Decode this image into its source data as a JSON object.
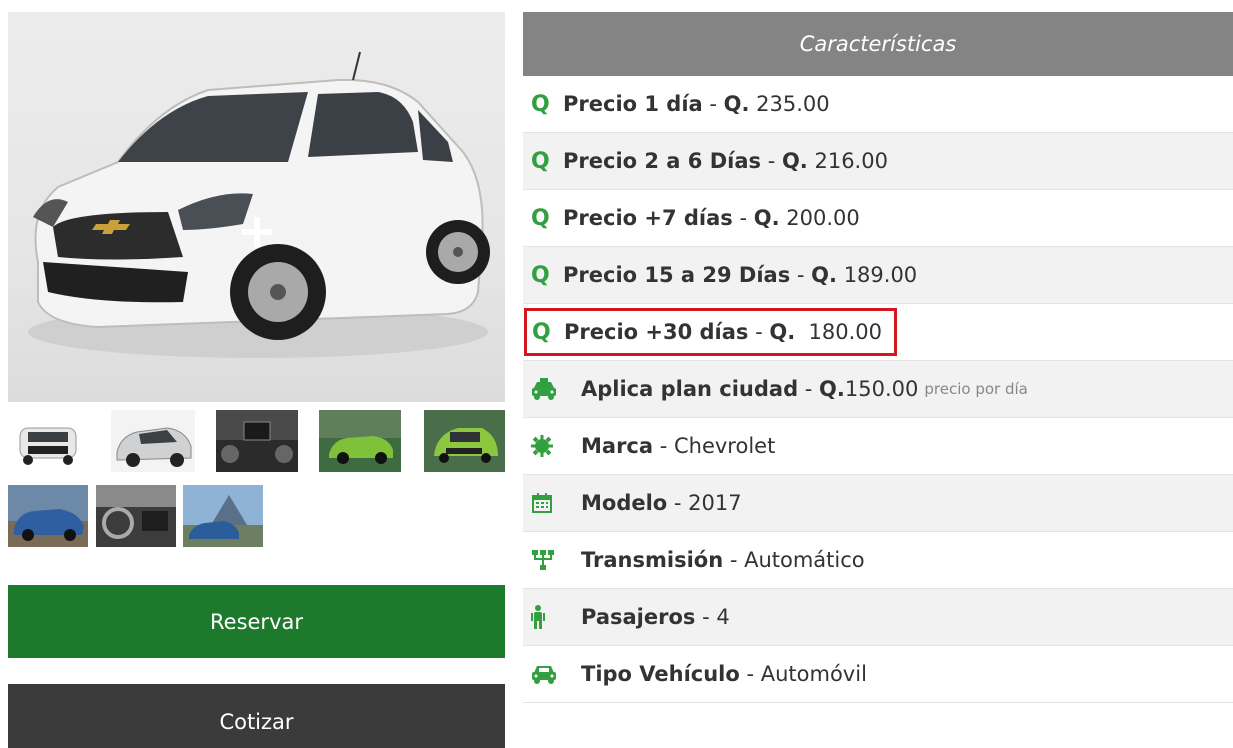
{
  "gallery": {
    "thumbnails_row1": [
      "car-front-white",
      "car-side-silver",
      "car-dashboard",
      "car-green-side",
      "car-green-front"
    ],
    "thumbnails_row2": [
      "car-blue-road",
      "car-interior",
      "car-blue-volcano"
    ]
  },
  "buttons": {
    "reservar": "Reservar",
    "cotizar": "Cotizar"
  },
  "features": {
    "header": "Características",
    "rows": [
      {
        "icon": "quetzal-icon",
        "label": "Precio 1 día",
        "sep": " - ",
        "currency": "Q.",
        "value": " 235.00"
      },
      {
        "icon": "quetzal-icon",
        "label": "Precio 2 a 6 Días",
        "sep": " - ",
        "currency": "Q.",
        "value": " 216.00"
      },
      {
        "icon": "quetzal-icon",
        "label": "Precio +7 días",
        "sep": " - ",
        "currency": "Q.",
        "value": " 200.00"
      },
      {
        "icon": "quetzal-icon",
        "label": "Precio 15 a 29 Días",
        "sep": " - ",
        "currency": "Q.",
        "value": " 189.00"
      },
      {
        "icon": "quetzal-icon",
        "label": "Precio +30 días",
        "sep": " - ",
        "currency": "Q.",
        "value": "  180.00",
        "highlighted": true
      },
      {
        "icon": "taxi-icon",
        "label": "Aplica plan ciudad",
        "sep": " - ",
        "currency": "Q.",
        "value": "150.00",
        "note": "precio por día"
      },
      {
        "icon": "gear-icon",
        "label": "Marca",
        "sep": " - ",
        "value": "Chevrolet"
      },
      {
        "icon": "calendar-icon",
        "label": "Modelo",
        "sep": " - ",
        "value": "2017"
      },
      {
        "icon": "transmission-icon",
        "label": "Transmisión",
        "sep": " - ",
        "value": "Automático"
      },
      {
        "icon": "person-icon",
        "label": "Pasajeros",
        "sep": " - ",
        "value": "4"
      },
      {
        "icon": "car-icon",
        "label": "Tipo Vehículo",
        "sep": " - ",
        "value": "Automóvil"
      }
    ]
  },
  "colors": {
    "accent_green": "#1d7a2c",
    "icon_green": "#32a041",
    "header_gray": "#848484",
    "dark_button": "#3b3b3b",
    "highlight_red": "#d3161f"
  }
}
